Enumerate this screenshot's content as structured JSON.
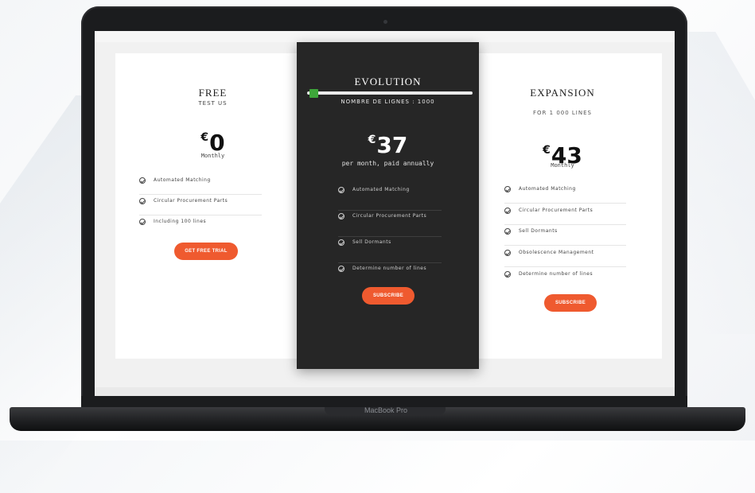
{
  "laptop": {
    "brand": "MacBook Pro"
  },
  "plans": {
    "free": {
      "title": "FREE",
      "subtitle": "TEST US",
      "currency": "€",
      "price": "0",
      "period": "Monthly",
      "features": [
        "Automated Matching",
        "Circular Procurement Parts",
        "Including 100 lines"
      ],
      "button": "GET FREE TRIAL"
    },
    "evolution": {
      "title": "EVOLUTION",
      "slider_label": "NOMBRE DE LIGNES : 1000",
      "slider_value": 0.03,
      "currency": "€",
      "price": "37",
      "period": "per month, paid annually",
      "features": [
        "Automated Matching",
        "Circular Procurement Parts",
        "Sell Dormants",
        "Determine number of lines"
      ],
      "button": "SUBSCRIBE"
    },
    "expansion": {
      "title": "EXPANSION",
      "subtitle": "FOR 1 000 LINES",
      "currency": "€",
      "price": "43",
      "period": "Monthly",
      "features": [
        "Automated Matching",
        "Circular Procurement Parts",
        "Sell Dormants",
        "Obsolescence Management",
        "Determine number of lines"
      ],
      "button": "SUBSCRIBE"
    }
  },
  "colors": {
    "accent": "#ef5a2f",
    "slider_thumb": "#3ea63a",
    "dark_card": "#262626"
  },
  "icons": {
    "feature": "check-circle-icon"
  }
}
